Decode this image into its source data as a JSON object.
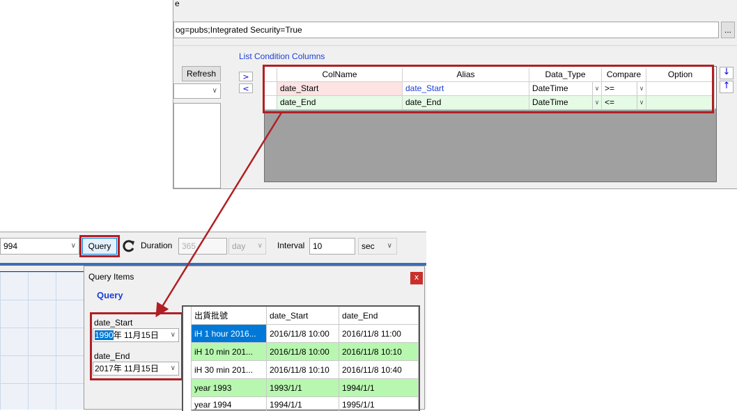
{
  "top": {
    "label_fragment": "e",
    "connection_string": "og=pubs;Integrated Security=True",
    "browse_label": "...",
    "refresh_label": "Refresh",
    "list_title": "List Condition Columns",
    "move_right": ">",
    "move_left": "<",
    "up_arrow": "↓",
    "down_arrow": "↑",
    "columns": [
      "ColName",
      "Alias",
      "Data_Type",
      "Compare",
      "Option"
    ],
    "rows": [
      {
        "colname": "date_Start",
        "alias": "date_Start",
        "data_type": "DateTime",
        "compare": ">=",
        "option": ""
      },
      {
        "colname": "date_End",
        "alias": "date_End",
        "data_type": "DateTime",
        "compare": "<=",
        "option": ""
      }
    ]
  },
  "toolbar": {
    "year_value": "994",
    "query_label": "Query",
    "duration_label": "Duration",
    "duration_value": "365",
    "duration_unit": "day",
    "interval_label": "Interval",
    "interval_value": "10",
    "interval_unit": "sec"
  },
  "dialog": {
    "title": "Query Items",
    "close_label": "x",
    "heading": "Query",
    "start_label": "date_Start",
    "start_value_selected": "1990",
    "start_value_rest": "年 11月15日",
    "end_label": "date_End",
    "end_value": "2017年 11月15日"
  },
  "results": {
    "columns": [
      "出貨批號",
      "date_Start",
      "date_End"
    ],
    "rows": [
      {
        "name": "iH 1 hour 2016...",
        "start": "2016/11/8 10:00",
        "end": "2016/11/8 11:00"
      },
      {
        "name": "iH 10 min 201...",
        "start": "2016/11/8 10:00",
        "end": "2016/11/8 10:10"
      },
      {
        "name": "iH 30 min 201...",
        "start": "2016/11/8 10:10",
        "end": "2016/11/8 10:40"
      },
      {
        "name": "year 1993",
        "start": "1993/1/1",
        "end": "1994/1/1"
      },
      {
        "name": "year 1994",
        "start": "1994/1/1",
        "end": "1995/1/1"
      }
    ]
  },
  "colors": {
    "highlight_red": "#b01f24",
    "row_pink": "#fde3e3",
    "row_green": "#e6fbe6",
    "result_green": "#b8f7b0",
    "selection_blue": "#0078d7"
  }
}
